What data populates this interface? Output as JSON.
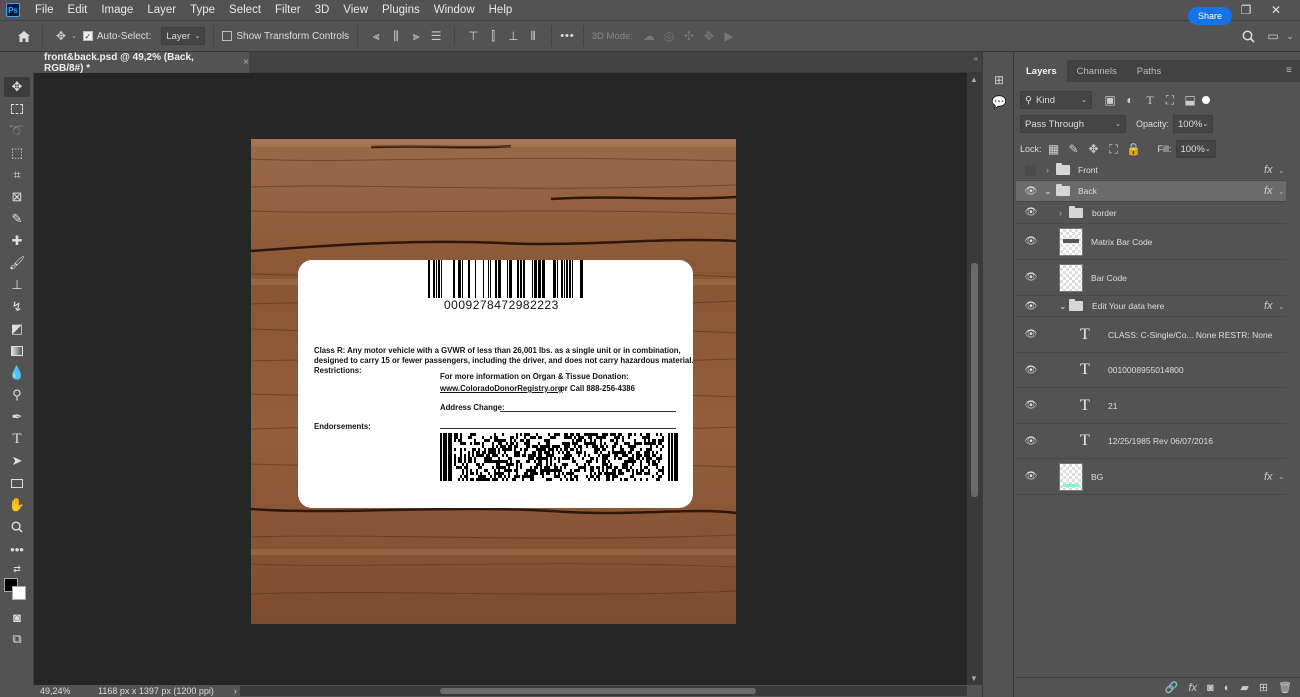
{
  "menubar": {
    "app_icon": "Ps",
    "items": [
      "File",
      "Edit",
      "Image",
      "Layer",
      "Type",
      "Select",
      "Filter",
      "3D",
      "View",
      "Plugins",
      "Window",
      "Help"
    ]
  },
  "options": {
    "auto_select_label": "Auto-Select:",
    "auto_select_checked": true,
    "auto_select_target": "Layer",
    "show_transform_label": "Show Transform Controls",
    "mode_3d_label": "3D Mode:",
    "more_label": "•••",
    "share_label": "Share"
  },
  "document": {
    "tab_title": "front&back.psd @ 49,2% (Back, RGB/8#) *",
    "close": "×"
  },
  "card": {
    "barcode_number": "0009278472982223",
    "class_line1": "Class R: Any motor vehicle with a GVWR of less than 26,001 lbs. as a single unit or in combination,",
    "class_line2": "designed to carry 15 or fewer passengers, including the driver, and does not carry hazardous material.",
    "restrictions": "Restrictions:",
    "organ_info": "For more information on Organ & Tissue Donation:",
    "organ_link": "www.ColoradoDonorRegistry.org",
    "organ_call": "or   Call 888-256-4386",
    "address_change": "Address Change:",
    "endorsements": "Endorsements:"
  },
  "status": {
    "zoom": "49,24%",
    "doc_info": "1168 px x 1397 px (1200 ppi)",
    "arrow": "›"
  },
  "panel": {
    "tabs": [
      "Layers",
      "Channels",
      "Paths"
    ],
    "filter_kind": "Kind",
    "blend_mode": "Pass Through",
    "opacity_label": "Opacity:",
    "opacity_value": "100%",
    "lock_label": "Lock:",
    "fill_label": "Fill:",
    "fill_value": "100%",
    "layers": [
      {
        "name": "Front",
        "type": "group",
        "visible": false,
        "fx": true
      },
      {
        "name": "Back",
        "type": "group",
        "visible": true,
        "fx": true,
        "selected": true
      },
      {
        "name": "border",
        "type": "group",
        "visible": true,
        "fx": false
      },
      {
        "name": "Matrix Bar Code",
        "type": "image",
        "visible": true,
        "fx": false
      },
      {
        "name": "Bar Code",
        "type": "image",
        "visible": true,
        "fx": false
      },
      {
        "name": "Edit Your data here",
        "type": "group",
        "visible": true,
        "fx": true
      },
      {
        "name": "CLASS: C-Single/Co... None RESTR: None",
        "type": "text",
        "visible": true,
        "fx": false
      },
      {
        "name": "0010008955014800",
        "type": "text",
        "visible": true,
        "fx": false
      },
      {
        "name": "21",
        "type": "text",
        "visible": true,
        "fx": false
      },
      {
        "name": "12/25/1985 Rev 06/07/2016",
        "type": "text",
        "visible": true,
        "fx": false
      },
      {
        "name": "BG",
        "type": "image",
        "visible": true,
        "fx": true
      }
    ],
    "type_glyph": "T",
    "fx_glyph": "fx"
  },
  "colors": {
    "accent": "#1473e6",
    "panel": "#535353",
    "canvas": "#262626",
    "wood": "#8d5a38"
  }
}
